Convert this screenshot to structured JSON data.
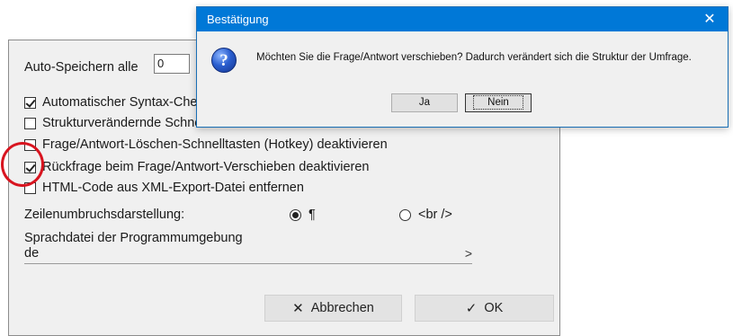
{
  "settings": {
    "autosave_label": "Auto-Speichern alle",
    "autosave_value": "0",
    "checkboxes": [
      {
        "label": "Automatischer Syntax-Check",
        "checked": true
      },
      {
        "label": "Strukturverändernde Schnelltasten deaktivieren",
        "checked": false
      },
      {
        "label": "Frage/Antwort-Löschen-Schnelltasten (Hotkey) deaktivieren",
        "checked": false
      },
      {
        "label": "Rückfrage beim Frage/Antwort-Verschieben deaktivieren",
        "checked": true
      },
      {
        "label": "HTML-Code aus XML-Export-Datei entfernen",
        "checked": false
      }
    ],
    "linebreak_label": "Zeilenumbruchsdarstellung:",
    "linebreak_options": [
      {
        "label": "¶",
        "selected": true
      },
      {
        "label": "<br />",
        "selected": false
      }
    ],
    "language_label": "Sprachdatei der Programmumgebung",
    "language_value": "de",
    "language_chevron": ">",
    "cancel_label": "Abbrechen",
    "cancel_icon": "✕",
    "ok_label": "OK",
    "ok_icon": "✓"
  },
  "dialog": {
    "title": "Bestätigung",
    "close_glyph": "✕",
    "icon_glyph": "?",
    "message": "Möchten Sie die Frage/Antwort verschieben? Dadurch verändert sich die Struktur der Umfrage.",
    "yes_label": "Ja",
    "no_label": "Nein"
  },
  "colors": {
    "dialog_titlebar": "#0078d7",
    "annotation_circle": "#d8141f"
  }
}
